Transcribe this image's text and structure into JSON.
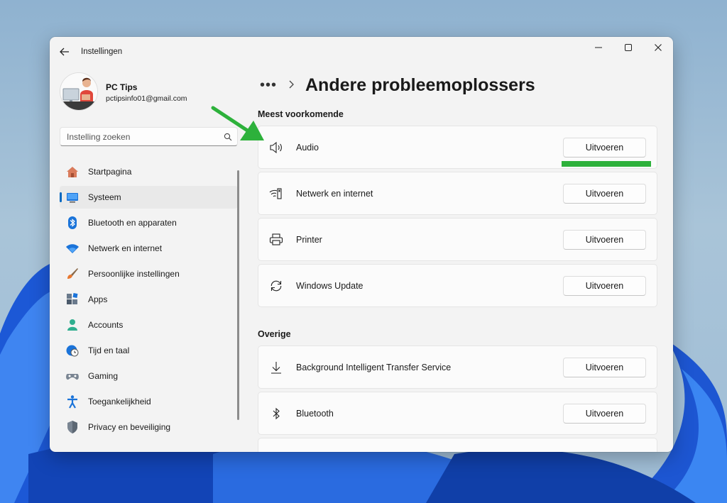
{
  "window": {
    "app_title": "Instellingen",
    "controls": {
      "minimize": "minimize-icon",
      "maximize": "maximize-icon",
      "close": "close-icon"
    }
  },
  "profile": {
    "name": "PC Tips",
    "email": "pctipsinfo01@gmail.com"
  },
  "search": {
    "placeholder": "Instelling zoeken"
  },
  "sidebar": {
    "items": [
      {
        "label": "Startpagina",
        "icon": "home-icon",
        "active": false
      },
      {
        "label": "Systeem",
        "icon": "monitor-icon",
        "active": true
      },
      {
        "label": "Bluetooth en apparaten",
        "icon": "bluetooth-icon",
        "active": false
      },
      {
        "label": "Netwerk en internet",
        "icon": "wifi-icon",
        "active": false
      },
      {
        "label": "Persoonlijke instellingen",
        "icon": "brush-icon",
        "active": false
      },
      {
        "label": "Apps",
        "icon": "apps-icon",
        "active": false
      },
      {
        "label": "Accounts",
        "icon": "person-icon",
        "active": false
      },
      {
        "label": "Tijd en taal",
        "icon": "clock-globe-icon",
        "active": false
      },
      {
        "label": "Gaming",
        "icon": "gamepad-icon",
        "active": false
      },
      {
        "label": "Toegankelijkheid",
        "icon": "accessibility-icon",
        "active": false
      },
      {
        "label": "Privacy en beveiliging",
        "icon": "shield-icon",
        "active": false
      }
    ]
  },
  "breadcrumb": {
    "more": "•••",
    "title": "Andere probleemoplossers"
  },
  "sections": {
    "common": {
      "title": "Meest voorkomende",
      "items": [
        {
          "label": "Audio",
          "icon": "speaker-icon",
          "button": "Uitvoeren"
        },
        {
          "label": "Netwerk en internet",
          "icon": "network-icon",
          "button": "Uitvoeren"
        },
        {
          "label": "Printer",
          "icon": "printer-icon",
          "button": "Uitvoeren"
        },
        {
          "label": "Windows Update",
          "icon": "sync-icon",
          "button": "Uitvoeren"
        }
      ]
    },
    "other": {
      "title": "Overige",
      "items": [
        {
          "label": "Background Intelligent Transfer Service",
          "icon": "download-icon",
          "button": "Uitvoeren"
        },
        {
          "label": "Bluetooth",
          "icon": "bluetooth-icon",
          "button": "Uitvoeren"
        }
      ]
    }
  },
  "colors": {
    "accent": "#0067c0",
    "annotation": "#2db13b"
  }
}
